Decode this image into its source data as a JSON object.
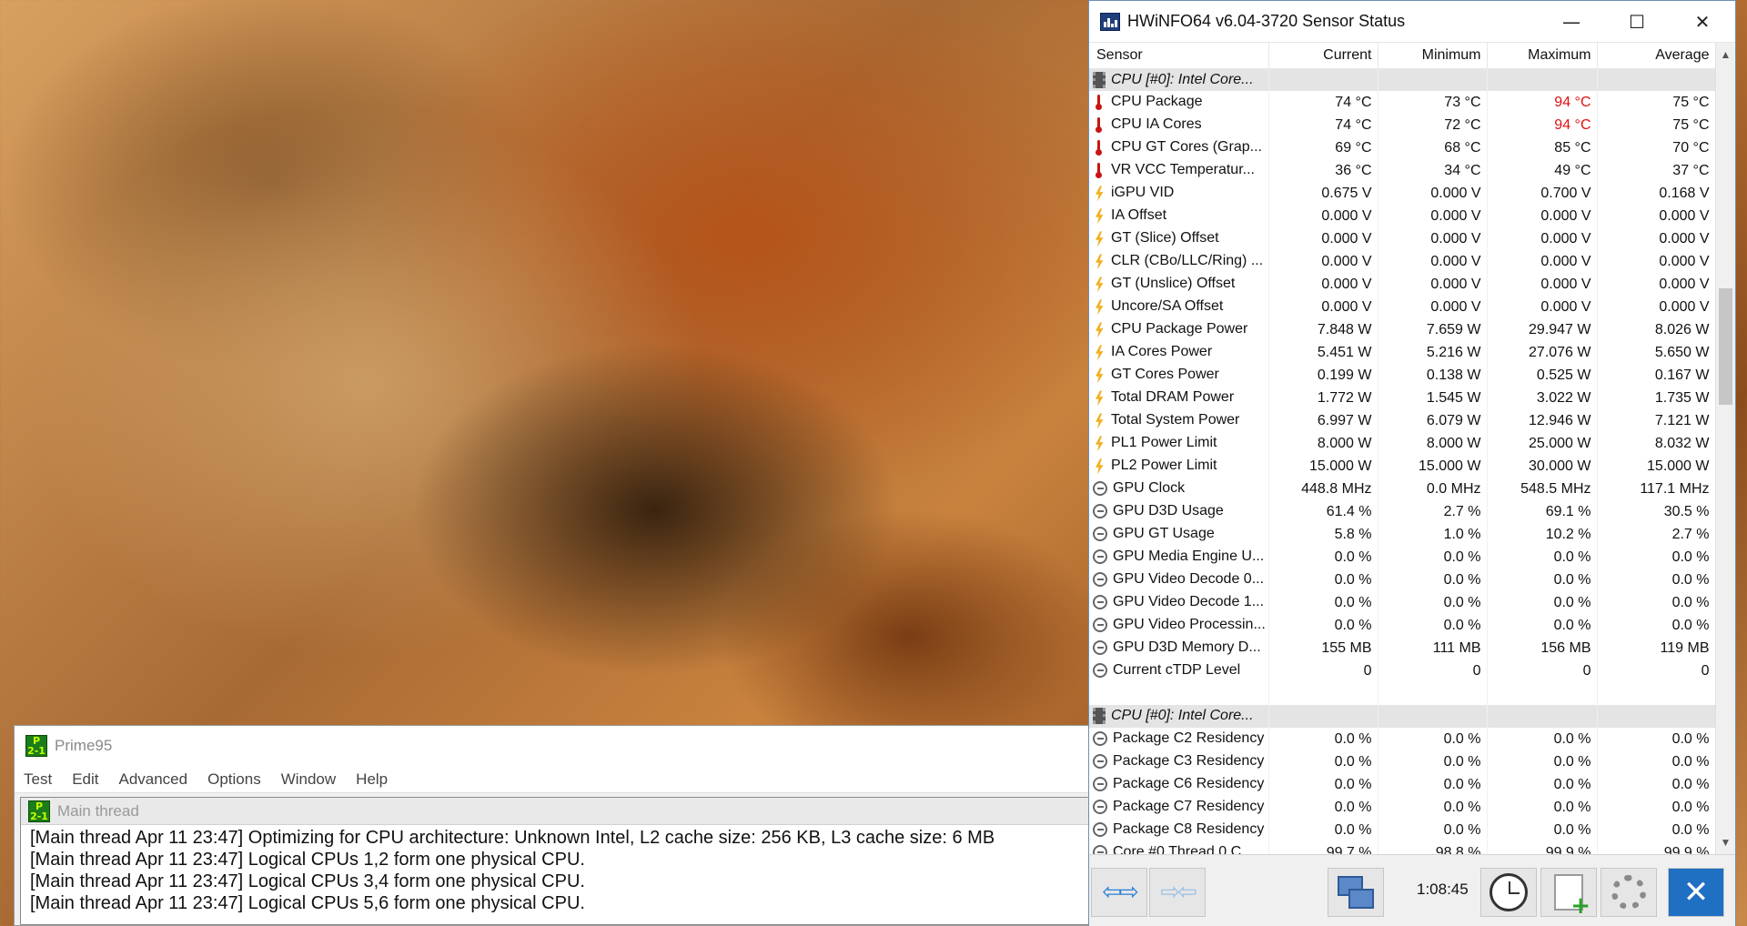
{
  "prime95": {
    "title": "Prime95",
    "app_icon_text": "P\n2-1",
    "menu": [
      "Test",
      "Edit",
      "Advanced",
      "Options",
      "Window",
      "Help"
    ],
    "child_title": "Main thread",
    "log": [
      "[Main thread Apr 11 23:47] Optimizing for CPU architecture: Unknown Intel, L2 cache size: 256 KB, L3 cache size: 6 MB",
      "[Main thread Apr 11 23:47] Logical CPUs 1,2 form one physical CPU.",
      "[Main thread Apr 11 23:47] Logical CPUs 3,4 form one physical CPU.",
      "[Main thread Apr 11 23:47] Logical CPUs 5,6 form one physical CPU."
    ]
  },
  "hwinfo": {
    "title": "HWiNFO64 v6.04-3720 Sensor Status",
    "window_buttons": {
      "minimize": "—",
      "maximize": "☐",
      "close": "✕"
    },
    "columns": [
      "Sensor",
      "Current",
      "Minimum",
      "Maximum",
      "Average"
    ],
    "rows": [
      {
        "kind": "group",
        "icon": "chip-icon",
        "name": "CPU [#0]: Intel Core..."
      },
      {
        "icon": "thermometer-icon",
        "name": "CPU Package",
        "values": [
          "74 °C",
          "73 °C",
          "94 °C",
          "75 °C"
        ],
        "hot": [
          false,
          false,
          true,
          false
        ]
      },
      {
        "icon": "thermometer-icon",
        "name": "CPU IA Cores",
        "values": [
          "74 °C",
          "72 °C",
          "94 °C",
          "75 °C"
        ],
        "hot": [
          false,
          false,
          true,
          false
        ]
      },
      {
        "icon": "thermometer-icon",
        "name": "CPU GT Cores (Grap...",
        "values": [
          "69 °C",
          "68 °C",
          "85 °C",
          "70 °C"
        ]
      },
      {
        "icon": "thermometer-icon",
        "name": "VR VCC Temperatur...",
        "values": [
          "36 °C",
          "34 °C",
          "49 °C",
          "37 °C"
        ]
      },
      {
        "icon": "lightning-icon",
        "name": "iGPU VID",
        "values": [
          "0.675 V",
          "0.000 V",
          "0.700 V",
          "0.168 V"
        ]
      },
      {
        "icon": "lightning-icon",
        "name": "IA Offset",
        "values": [
          "0.000 V",
          "0.000 V",
          "0.000 V",
          "0.000 V"
        ]
      },
      {
        "icon": "lightning-icon",
        "name": "GT (Slice) Offset",
        "values": [
          "0.000 V",
          "0.000 V",
          "0.000 V",
          "0.000 V"
        ]
      },
      {
        "icon": "lightning-icon",
        "name": "CLR (CBo/LLC/Ring) ...",
        "values": [
          "0.000 V",
          "0.000 V",
          "0.000 V",
          "0.000 V"
        ]
      },
      {
        "icon": "lightning-icon",
        "name": "GT (Unslice) Offset",
        "values": [
          "0.000 V",
          "0.000 V",
          "0.000 V",
          "0.000 V"
        ]
      },
      {
        "icon": "lightning-icon",
        "name": "Uncore/SA Offset",
        "values": [
          "0.000 V",
          "0.000 V",
          "0.000 V",
          "0.000 V"
        ]
      },
      {
        "icon": "lightning-icon",
        "name": "CPU Package Power",
        "values": [
          "7.848 W",
          "7.659 W",
          "29.947 W",
          "8.026 W"
        ]
      },
      {
        "icon": "lightning-icon",
        "name": "IA Cores Power",
        "values": [
          "5.451 W",
          "5.216 W",
          "27.076 W",
          "5.650 W"
        ]
      },
      {
        "icon": "lightning-icon",
        "name": "GT Cores Power",
        "values": [
          "0.199 W",
          "0.138 W",
          "0.525 W",
          "0.167 W"
        ]
      },
      {
        "icon": "lightning-icon",
        "name": "Total DRAM Power",
        "values": [
          "1.772 W",
          "1.545 W",
          "3.022 W",
          "1.735 W"
        ]
      },
      {
        "icon": "lightning-icon",
        "name": "Total System Power",
        "values": [
          "6.997 W",
          "6.079 W",
          "12.946 W",
          "7.121 W"
        ]
      },
      {
        "icon": "lightning-icon",
        "name": "PL1 Power Limit",
        "values": [
          "8.000 W",
          "8.000 W",
          "25.000 W",
          "8.032 W"
        ]
      },
      {
        "icon": "lightning-icon",
        "name": "PL2 Power Limit",
        "values": [
          "15.000 W",
          "15.000 W",
          "30.000 W",
          "15.000 W"
        ]
      },
      {
        "icon": "gauge-icon",
        "name": "GPU Clock",
        "values": [
          "448.8 MHz",
          "0.0 MHz",
          "548.5 MHz",
          "117.1 MHz"
        ]
      },
      {
        "icon": "gauge-icon",
        "name": "GPU D3D Usage",
        "values": [
          "61.4 %",
          "2.7 %",
          "69.1 %",
          "30.5 %"
        ]
      },
      {
        "icon": "gauge-icon",
        "name": "GPU GT Usage",
        "values": [
          "5.8 %",
          "1.0 %",
          "10.2 %",
          "2.7 %"
        ]
      },
      {
        "icon": "gauge-icon",
        "name": "GPU Media Engine U...",
        "values": [
          "0.0 %",
          "0.0 %",
          "0.0 %",
          "0.0 %"
        ]
      },
      {
        "icon": "gauge-icon",
        "name": "GPU Video Decode 0...",
        "values": [
          "0.0 %",
          "0.0 %",
          "0.0 %",
          "0.0 %"
        ]
      },
      {
        "icon": "gauge-icon",
        "name": "GPU Video Decode 1...",
        "values": [
          "0.0 %",
          "0.0 %",
          "0.0 %",
          "0.0 %"
        ]
      },
      {
        "icon": "gauge-icon",
        "name": "GPU Video Processin...",
        "values": [
          "0.0 %",
          "0.0 %",
          "0.0 %",
          "0.0 %"
        ]
      },
      {
        "icon": "gauge-icon",
        "name": "GPU D3D Memory D...",
        "values": [
          "155 MB",
          "111 MB",
          "156 MB",
          "119 MB"
        ]
      },
      {
        "icon": "gauge-icon",
        "name": "Current cTDP Level",
        "values": [
          "0",
          "0",
          "0",
          "0"
        ]
      },
      {
        "kind": "spacer"
      },
      {
        "kind": "group",
        "icon": "chip-icon",
        "name": "CPU [#0]: Intel Core..."
      },
      {
        "icon": "gauge-icon",
        "name": "Package C2 Residency",
        "values": [
          "0.0 %",
          "0.0 %",
          "0.0 %",
          "0.0 %"
        ]
      },
      {
        "icon": "gauge-icon",
        "name": "Package C3 Residency",
        "values": [
          "0.0 %",
          "0.0 %",
          "0.0 %",
          "0.0 %"
        ]
      },
      {
        "icon": "gauge-icon",
        "name": "Package C6 Residency",
        "values": [
          "0.0 %",
          "0.0 %",
          "0.0 %",
          "0.0 %"
        ]
      },
      {
        "icon": "gauge-icon",
        "name": "Package C7 Residency",
        "values": [
          "0.0 %",
          "0.0 %",
          "0.0 %",
          "0.0 %"
        ]
      },
      {
        "icon": "gauge-icon",
        "name": "Package C8 Residency",
        "values": [
          "0.0 %",
          "0.0 %",
          "0.0 %",
          "0.0 %"
        ]
      },
      {
        "icon": "gauge-icon",
        "name": "Core #0 Thread 0 C...",
        "values": [
          "99.7 %",
          "98.8 %",
          "99.9 %",
          "99.9 %"
        ]
      }
    ],
    "toolbar": {
      "elapsed_time": "1:08:45",
      "nav_back_forward": "⇦⇨",
      "nav_collapse": "⇨⇦"
    },
    "colors": {
      "hot_value": "#e01010",
      "group_row": "#e4e4e4",
      "close_button": "#1f6fc2"
    }
  }
}
